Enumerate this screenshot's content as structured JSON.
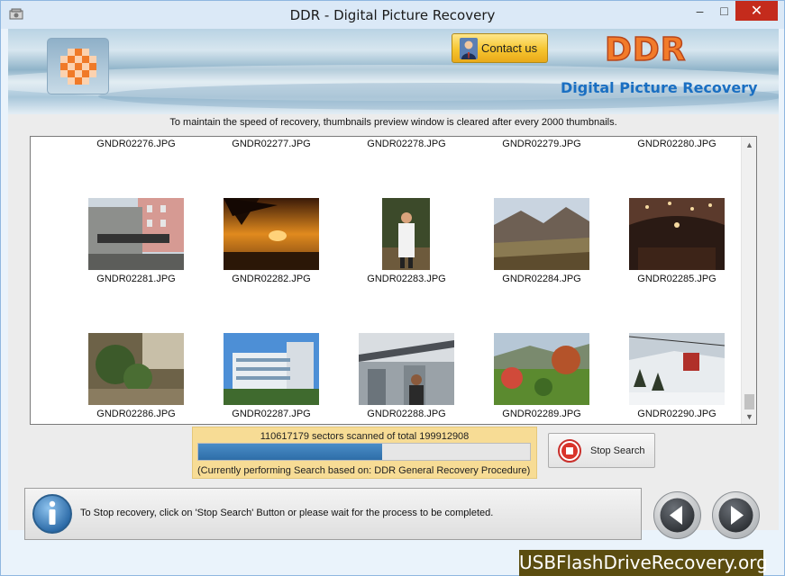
{
  "window": {
    "title": "DDR - Digital Picture Recovery"
  },
  "banner": {
    "contact_label": "Contact us",
    "brand": "DDR",
    "brand_subtitle": "Digital Picture Recovery",
    "brand_color": "#f27b2a",
    "subtitle_color": "#1a6fc2"
  },
  "notice": "To maintain the speed of recovery, thumbnails preview window is cleared after every 2000 thumbnails.",
  "thumbnails": {
    "row0": [
      "GNDR02276.JPG",
      "GNDR02277.JPG",
      "GNDR02278.JPG",
      "GNDR02279.JPG",
      "GNDR02280.JPG"
    ],
    "row1": [
      "GNDR02281.JPG",
      "GNDR02282.JPG",
      "GNDR02283.JPG",
      "GNDR02284.JPG",
      "GNDR02285.JPG"
    ],
    "row2": [
      "GNDR02286.JPG",
      "GNDR02287.JPG",
      "GNDR02288.JPG",
      "GNDR02289.JPG",
      "GNDR02290.JPG"
    ]
  },
  "progress": {
    "sectors_text": "110617179 sectors scanned of total 199912908",
    "fraction": 0.5533,
    "status_text": "(Currently performing Search based on:  DDR General Recovery Procedure)"
  },
  "stop_button": {
    "label": "Stop Search"
  },
  "info": {
    "message": "To Stop recovery, click on 'Stop Search' Button or please wait for the process to be completed."
  },
  "watermark": "USBFlashDriveRecovery.org",
  "icons": {
    "app": "app-icon",
    "minimize": "minimize-icon",
    "maximize": "maximize-icon",
    "close": "close-icon",
    "contact": "person-icon",
    "stop": "stop-icon",
    "info": "info-icon",
    "back": "arrow-left-icon",
    "next": "arrow-right-icon"
  }
}
